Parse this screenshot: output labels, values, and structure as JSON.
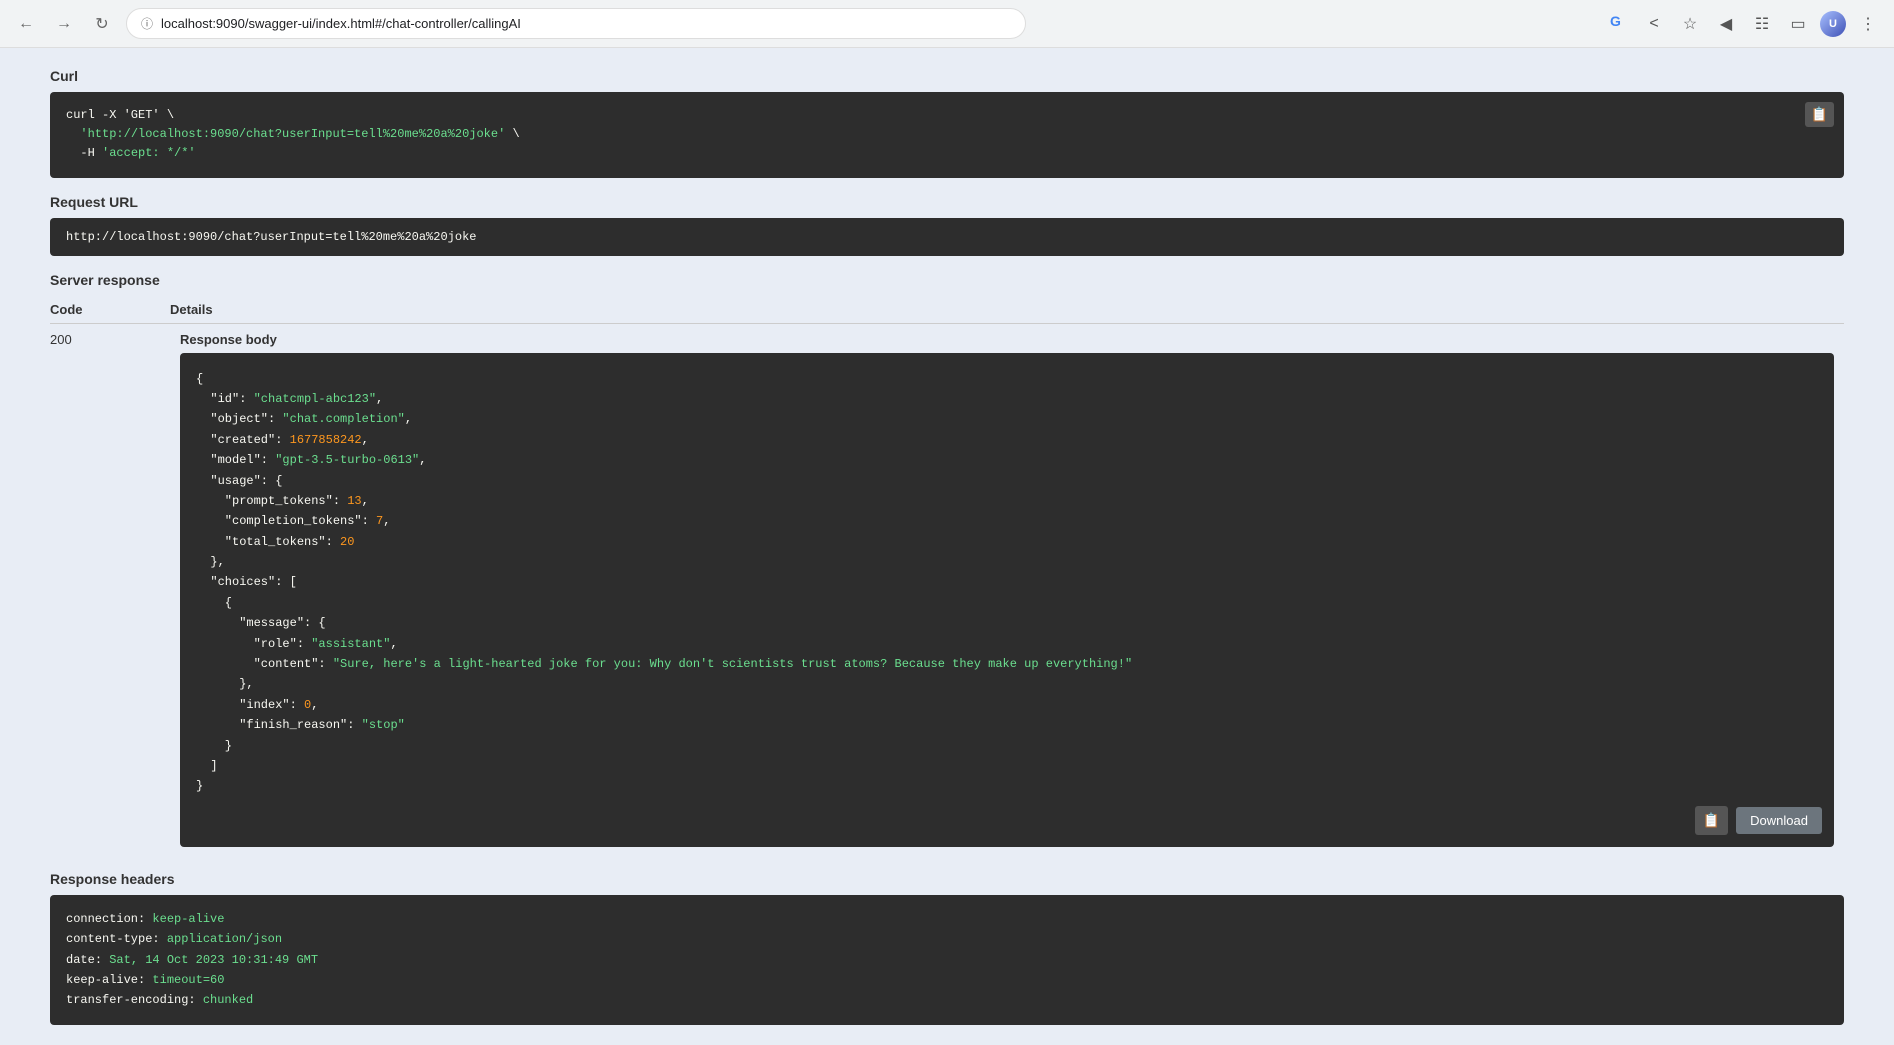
{
  "browser": {
    "url": "localhost:9090/swagger-ui/index.html#/chat-controller/callingAI",
    "back_disabled": false,
    "forward_disabled": false
  },
  "curl_section": {
    "label": "Curl",
    "command_line1": "curl -X 'GET' \\",
    "command_line2": "  'http://localhost:9090/chat?userInput=tell%20me%20a%20joke' \\",
    "command_line3": "  -H 'accept: */*'"
  },
  "request_url_section": {
    "label": "Request URL",
    "url": "http://localhost:9090/chat?userInput=tell%20me%20a%20joke"
  },
  "server_response": {
    "label": "Server response",
    "code_col": "Code",
    "details_col": "Details",
    "code": "200",
    "response_body_label": "Response body",
    "json_content": {
      "id": "chatcmpl-abc123",
      "object": "chat.completion",
      "created": 1677858242,
      "model": "gpt-3.5-turbo-0613",
      "usage": {
        "prompt_tokens": 13,
        "completion_tokens": 7,
        "total_tokens": 20
      },
      "choices_role": "assistant",
      "choices_content": "Sure, here's a light-hearted joke for you: Why don't scientists trust atoms? Because they make up everything!",
      "choices_index": 0,
      "choices_finish_reason": "stop"
    },
    "download_label": "Download"
  },
  "response_headers": {
    "label": "Response headers",
    "headers": [
      {
        "key": "connection",
        "value": "keep-alive"
      },
      {
        "key": "content-type",
        "value": "application/json"
      },
      {
        "key": "date",
        "value": "Sat, 14 Oct 2023 10:31:49 GMT"
      },
      {
        "key": "keep-alive",
        "value": "timeout=60"
      },
      {
        "key": "transfer-encoding",
        "value": "chunked"
      }
    ]
  }
}
